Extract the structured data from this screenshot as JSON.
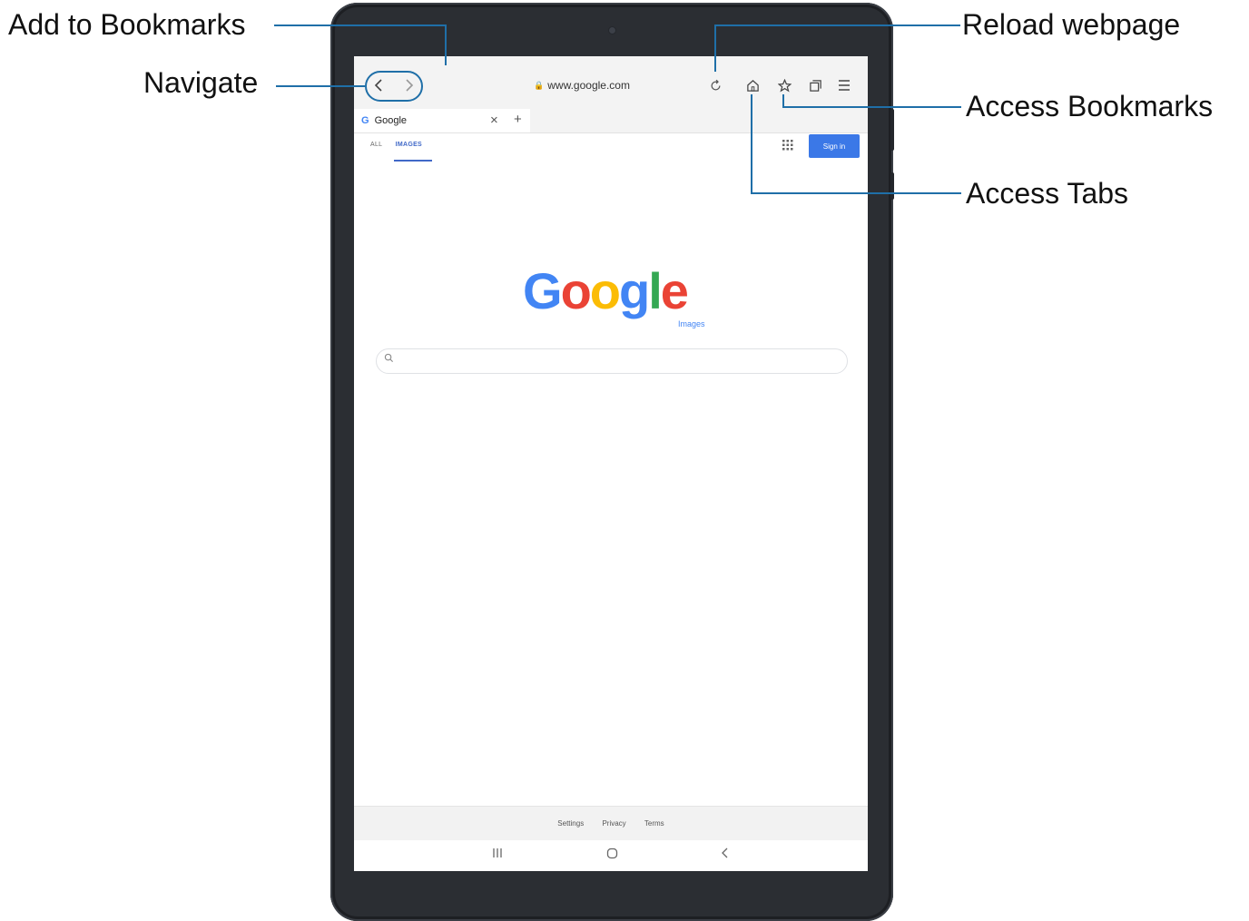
{
  "callouts": {
    "add_bookmarks": "Add to Bookmarks",
    "navigate": "Navigate",
    "reload": "Reload webpage",
    "access_bookmarks": "Access Bookmarks",
    "access_tabs": "Access Tabs"
  },
  "browser": {
    "url": "www.google.com",
    "tab_title": "Google",
    "tab_favicon": "G",
    "new_tab_glyph": "+",
    "close_glyph": "×",
    "icons": {
      "back": "back-arrow-icon",
      "forward": "forward-arrow-icon",
      "bookmark_add": "star-icon",
      "reload": "reload-icon",
      "home": "home-icon",
      "bookmarks": "bookmarks-star-icon",
      "tabs": "tabs-icon",
      "menu": "menu-icon"
    }
  },
  "page": {
    "nav_all": "ALL",
    "nav_images": "IMAGES",
    "sign_in": "Sign in",
    "logo_sub": "Images",
    "footer": {
      "settings": "Settings",
      "privacy": "Privacy",
      "terms": "Terms"
    }
  },
  "colors": {
    "accent_line": "#1f6fa8",
    "google_blue": "#4285F4",
    "google_red": "#EA4335",
    "google_yellow": "#FBBC05",
    "google_green": "#34A853",
    "sign_in_button": "#3b78e7"
  }
}
